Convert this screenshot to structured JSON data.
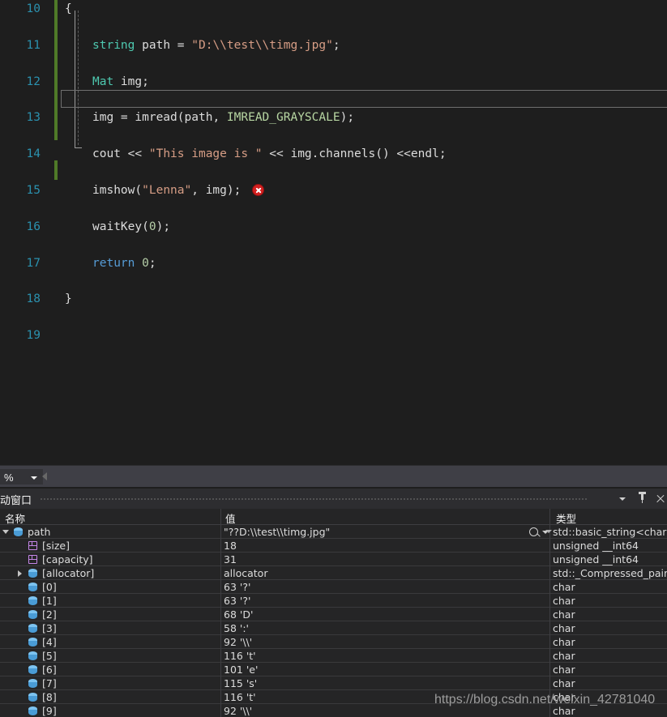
{
  "editor": {
    "name": "visual-studio-code-editor",
    "theme_background": "#1e1e1e",
    "current_line": 15,
    "error_marker": "error-icon",
    "lines": [
      {
        "number": "10",
        "tokens": [
          {
            "t": "{",
            "c": "c-punc"
          }
        ],
        "indent": 0,
        "gutter_brace": true
      },
      {
        "number": "11",
        "tokens": [
          {
            "t": "string",
            "c": "c-type"
          },
          {
            "t": " ",
            "c": "c-id"
          },
          {
            "t": "path",
            "c": "c-id"
          },
          {
            "t": " = ",
            "c": "c-op"
          },
          {
            "t": "\"D:\\\\test\\\\timg.jpg\"",
            "c": "c-str"
          },
          {
            "t": ";",
            "c": "c-punc"
          }
        ]
      },
      {
        "number": "12",
        "tokens": [
          {
            "t": "Mat",
            "c": "c-type"
          },
          {
            "t": " img",
            "c": "c-id"
          },
          {
            "t": ";",
            "c": "c-punc"
          }
        ]
      },
      {
        "number": "13",
        "tokens": [
          {
            "t": "img = ",
            "c": "c-id"
          },
          {
            "t": "imread",
            "c": "c-id"
          },
          {
            "t": "(",
            "c": "c-punc"
          },
          {
            "t": "path",
            "c": "c-id"
          },
          {
            "t": ", ",
            "c": "c-punc"
          },
          {
            "t": "IMREAD_GRAYSCALE",
            "c": "c-enum"
          },
          {
            "t": ")",
            "c": "c-punc"
          },
          {
            "t": ";",
            "c": "c-punc"
          }
        ]
      },
      {
        "number": "14",
        "tokens": [
          {
            "t": "cout ",
            "c": "c-id"
          },
          {
            "t": "<< ",
            "c": "c-op"
          },
          {
            "t": "\"This image is \"",
            "c": "c-str"
          },
          {
            "t": " << ",
            "c": "c-op"
          },
          {
            "t": "img.channels",
            "c": "c-id"
          },
          {
            "t": "()",
            "c": "c-punc"
          },
          {
            "t": " <<",
            "c": "c-op"
          },
          {
            "t": "endl",
            "c": "c-id"
          },
          {
            "t": ";",
            "c": "c-punc"
          }
        ]
      },
      {
        "number": "15",
        "tokens": [
          {
            "t": "imshow",
            "c": "c-id"
          },
          {
            "t": "(",
            "c": "c-punc"
          },
          {
            "t": "\"Lenna\"",
            "c": "c-str"
          },
          {
            "t": ", ",
            "c": "c-punc"
          },
          {
            "t": "img",
            "c": "c-id"
          },
          {
            "t": ")",
            "c": "c-punc"
          },
          {
            "t": ";",
            "c": "c-punc"
          }
        ],
        "has_error": true
      },
      {
        "number": "16",
        "tokens": [
          {
            "t": "waitKey",
            "c": "c-id"
          },
          {
            "t": "(",
            "c": "c-punc"
          },
          {
            "t": "0",
            "c": "c-num"
          },
          {
            "t": ")",
            "c": "c-punc"
          },
          {
            "t": ";",
            "c": "c-punc"
          }
        ]
      },
      {
        "number": "17",
        "tokens": [
          {
            "t": "return",
            "c": "c-kw"
          },
          {
            "t": " ",
            "c": "c-id"
          },
          {
            "t": "0",
            "c": "c-num"
          },
          {
            "t": ";",
            "c": "c-punc"
          }
        ]
      },
      {
        "number": "18",
        "tokens": [
          {
            "t": "}",
            "c": "c-punc"
          }
        ],
        "gutter_brace": true
      },
      {
        "number": "19",
        "tokens": []
      }
    ]
  },
  "editor_statusbar": {
    "name": "editor-zoom-statusbar",
    "zoom_value": "%",
    "scroll_left_arrow": "left-arrow-icon"
  },
  "autos_panel": {
    "title": "自动窗口",
    "toolbar": {
      "dropdown": "chevron-down-icon",
      "pin": "pin-icon",
      "close": "close-icon"
    },
    "columns": {
      "name": "名称",
      "value": "值",
      "type": "类型"
    },
    "rows": [
      {
        "name": "path",
        "value": "\"??D:\\\\test\\\\timg.jpg\"",
        "type": "std::basic_string<char,s...",
        "depth": 0,
        "expander": "open",
        "icon": "sphere-icon",
        "search": true,
        "type_caret": true
      },
      {
        "name": "[size]",
        "value": "18",
        "type": "unsigned __int64",
        "depth": 1,
        "expander": "none",
        "icon": "cube-icon"
      },
      {
        "name": "[capacity]",
        "value": "31",
        "type": "unsigned __int64",
        "depth": 1,
        "expander": "none",
        "icon": "cube-icon"
      },
      {
        "name": "[allocator]",
        "value": "allocator",
        "type": "std::_Compressed_pair...",
        "depth": 1,
        "expander": "closed",
        "icon": "sphere-icon"
      },
      {
        "name": "[0]",
        "value": "63 '?'",
        "type": "char",
        "depth": 1,
        "expander": "none",
        "icon": "sphere-icon"
      },
      {
        "name": "[1]",
        "value": "63 '?'",
        "type": "char",
        "depth": 1,
        "expander": "none",
        "icon": "sphere-icon"
      },
      {
        "name": "[2]",
        "value": "68 'D'",
        "type": "char",
        "depth": 1,
        "expander": "none",
        "icon": "sphere-icon"
      },
      {
        "name": "[3]",
        "value": "58 ':'",
        "type": "char",
        "depth": 1,
        "expander": "none",
        "icon": "sphere-icon"
      },
      {
        "name": "[4]",
        "value": "92 '\\\\'",
        "type": "char",
        "depth": 1,
        "expander": "none",
        "icon": "sphere-icon"
      },
      {
        "name": "[5]",
        "value": "116 't'",
        "type": "char",
        "depth": 1,
        "expander": "none",
        "icon": "sphere-icon"
      },
      {
        "name": "[6]",
        "value": "101 'e'",
        "type": "char",
        "depth": 1,
        "expander": "none",
        "icon": "sphere-icon"
      },
      {
        "name": "[7]",
        "value": "115 's'",
        "type": "char",
        "depth": 1,
        "expander": "none",
        "icon": "sphere-icon"
      },
      {
        "name": "[8]",
        "value": "116 't'",
        "type": "char",
        "depth": 1,
        "expander": "none",
        "icon": "sphere-icon"
      },
      {
        "name": "[9]",
        "value": "92 '\\\\'",
        "type": "char",
        "depth": 1,
        "expander": "none",
        "icon": "sphere-icon"
      }
    ]
  },
  "watermark": {
    "text": "https://blog.csdn.net/weixin_42781040"
  }
}
